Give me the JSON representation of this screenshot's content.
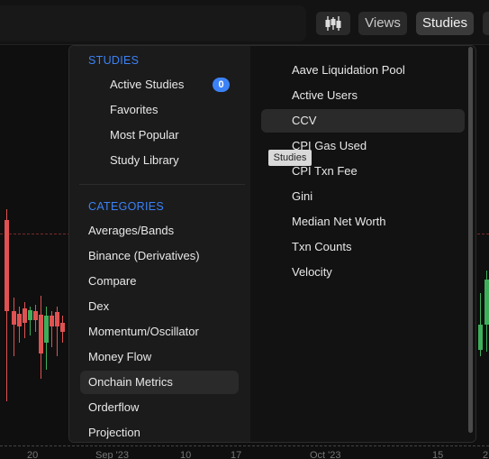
{
  "toolbar": {
    "candle_icon": "candlestick-icon",
    "views_label": "Views",
    "studies_label": "Studies"
  },
  "studies_menu": {
    "studies_header": "STUDIES",
    "studies_items": [
      "Active Studies",
      "Favorites",
      "Most Popular",
      "Study Library"
    ],
    "active_count": "0",
    "categories_header": "CATEGORIES",
    "categories": [
      "Averages/Bands",
      "Binance (Derivatives)",
      "Compare",
      "Dex",
      "Momentum/Oscillator",
      "Money Flow",
      "Onchain Metrics",
      "Orderflow",
      "Projection"
    ],
    "selected_category": "Onchain Metrics",
    "study_list": [
      "Aave Liquidation Pool",
      "Active Users",
      "CCV",
      "CPI Gas Used",
      "CPI Txn Fee",
      "Gini",
      "Median Net Worth",
      "Txn Counts",
      "Velocity"
    ],
    "hovered_study": "CCV",
    "tooltip": "Studies"
  },
  "xaxis": {
    "labels": [
      "20",
      "Sep '23",
      "10",
      "17",
      "Oct '23",
      "15",
      "2"
    ]
  },
  "colors": {
    "accent": "#3b82f6",
    "up": "#3fae5a",
    "down": "#e05252"
  }
}
